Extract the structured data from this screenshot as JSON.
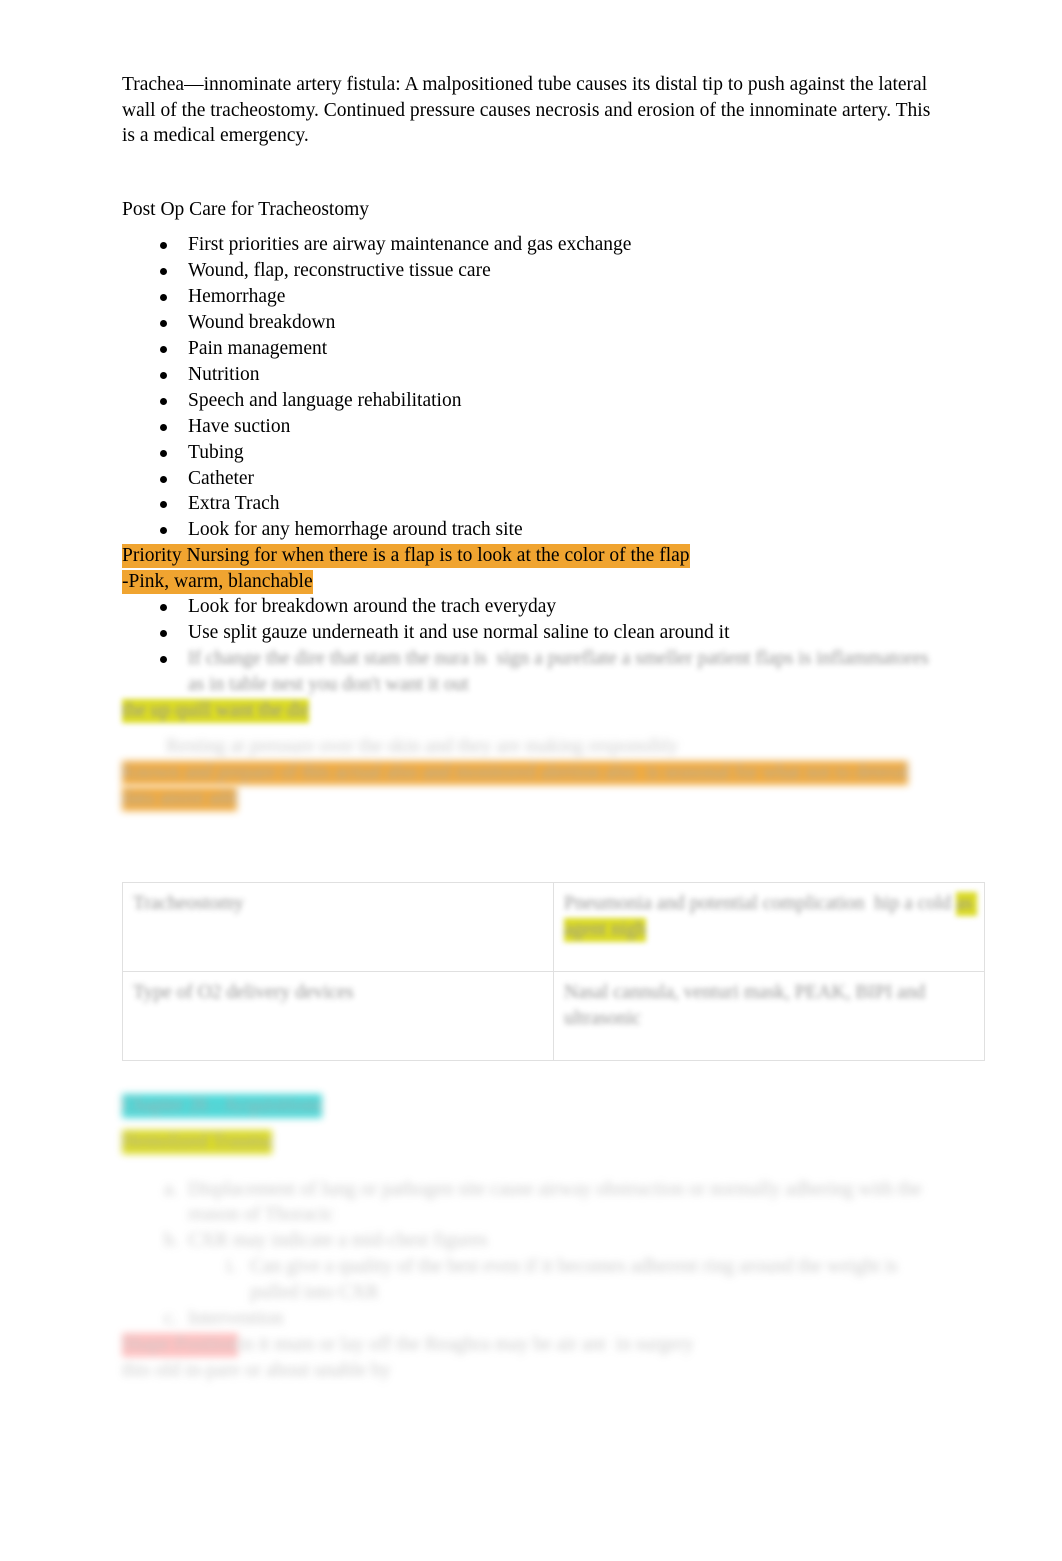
{
  "document": {
    "intro_paragraph": "Trachea—innominate artery fistula: A malpositioned tube causes its distal tip to push against the lateral wall of the tracheostomy. Continued pressure causes necrosis and erosion of the innominate artery.    This is a medical emergency.",
    "section_heading": "Post Op Care for Tracheostomy",
    "post_op_bullets": [
      "First priorities are airway maintenance and gas exchange",
      "Wound, flap, reconstructive tissue care",
      "Hemorrhage",
      "Wound breakdown",
      "Pain management",
      "Nutrition",
      "Speech and language rehabilitation",
      "Have suction",
      "Tubing",
      "Catheter",
      "Extra Trach",
      "Look for any hemorrhage around trach site"
    ],
    "priority_note": {
      "line1": "Priority Nursing for when there is a flap is to look at the color of the flap",
      "line2": "-Pink, warm, blanchable",
      "highlight_color": "#F0A430"
    },
    "care_bullets": [
      "Look for breakdown around the trach everyday",
      "Use split gauze underneath it and use normal saline to clean around it"
    ],
    "redacted": {
      "bullet_blurred_line1": "If change the dire that stam the nura is  sign a pureflate a smeller patient flaps is inflammatores as in table nest you don't want it out",
      "yellow_tag": "the up quill want the dir",
      "line_gray": "Resting at pressure over the skin and they are making responsibly",
      "orange_band_line1": "Known and prepare of this actual also and monitored alertion also  is seasonal for what not to deteral",
      "orange_band_line2": "data ansist add",
      "cyan_heading": "Chapter 26 - Acquisitions",
      "yellow_subheading": "Hemolized Trauma",
      "list_item_1": "Displacement of lung or pathogen site cause airway obstruction or normally adhering with the reason of Thoracic",
      "list_item_2": "CXR may indicate a mid-chest figures",
      "sublist_item_a": "Can give a quality of the best even if it becomes adherent ring around the weight is pulled into CXR",
      "list_item_3": "Intervention",
      "pink_tag": "Shape Position",
      "closing_line1": "in it mum or lay off the Reaghra may be air ant  in surgery",
      "closing_line2": "this old in-pare or about unable by"
    },
    "table": {
      "rows": [
        {
          "left": "Tracheostomy",
          "right_text": "Pneumonia and potential complication  hip a cold",
          "right_highlight": "as agent nigh"
        },
        {
          "left": "Type of O2 delivery devices",
          "right_text": "Nasal cannula, venturi mask, PEAK, BIPI and ultrasonic"
        }
      ]
    }
  }
}
